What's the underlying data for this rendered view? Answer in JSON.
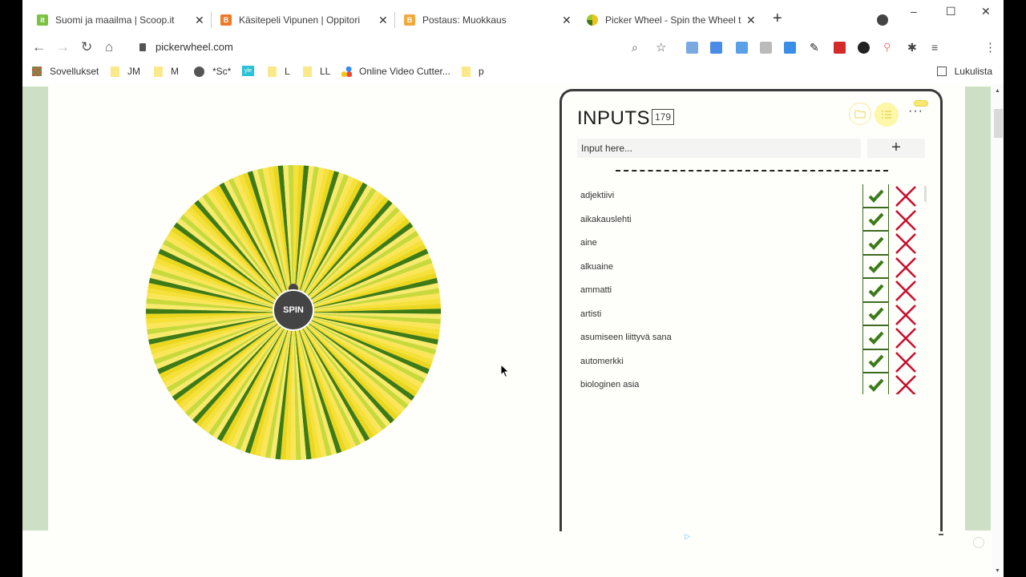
{
  "browser": {
    "tabs": [
      {
        "title": "Suomi ja maailma | Scoop.it",
        "favicon": "scoopit-icon",
        "color": "#7cc242"
      },
      {
        "title": "Käsitepeli Vipunen | Oppitori",
        "favicon": "blogger-icon",
        "color": "#ee7a28"
      },
      {
        "title": "Postaus: Muokkaus",
        "favicon": "blogger-icon",
        "color": "#f2a93b"
      },
      {
        "title": "Picker Wheel - Spin the Wheel t",
        "favicon": "pickerwheel-icon",
        "color": "#f0c420",
        "active": true
      }
    ],
    "new_tab": "+",
    "url": "pickerwheel.com",
    "window_controls": {
      "minimize": "–",
      "maximize": "☐",
      "close": "✕"
    },
    "bookmarks": [
      {
        "label": "Sovellukset",
        "type": "apps"
      },
      {
        "label": "JM",
        "type": "folder"
      },
      {
        "label": "M",
        "type": "folder"
      },
      {
        "label": "*Sc*",
        "type": "globe"
      },
      {
        "label": "",
        "type": "yle"
      },
      {
        "label": "L",
        "type": "folder"
      },
      {
        "label": "LL",
        "type": "folder"
      },
      {
        "label": "Online Video Cutter...",
        "type": "site"
      },
      {
        "label": "p",
        "type": "folder"
      }
    ],
    "reading_list": "Lukulista"
  },
  "wheel": {
    "spin_label": "SPIN",
    "segment_count": 179,
    "colors": [
      "#f5e13a",
      "#ecd71f",
      "#3e7a16",
      "#f8ea6a",
      "#c7d93b",
      "#fbe65a"
    ]
  },
  "inputs_panel": {
    "title": "INPUTS",
    "count": "179",
    "input_placeholder": "Input here...",
    "add_label": "+",
    "more_label": "···",
    "items": [
      {
        "label": "adjektiivi",
        "included": true
      },
      {
        "label": "aikakauslehti",
        "included": true
      },
      {
        "label": "aine",
        "included": true
      },
      {
        "label": "alkuaine",
        "included": true
      },
      {
        "label": "ammatti",
        "included": true
      },
      {
        "label": "artisti",
        "included": true
      },
      {
        "label": "asumiseen liittyvä sana",
        "included": true
      },
      {
        "label": "automerkki",
        "included": true
      },
      {
        "label": "biologinen asia",
        "included": true
      }
    ]
  },
  "colors": {
    "check_green": "#3c7a1a",
    "cross_red": "#c8102e",
    "side_green": "#cde0c5",
    "highlight_yellow": "#fdf7a8"
  }
}
